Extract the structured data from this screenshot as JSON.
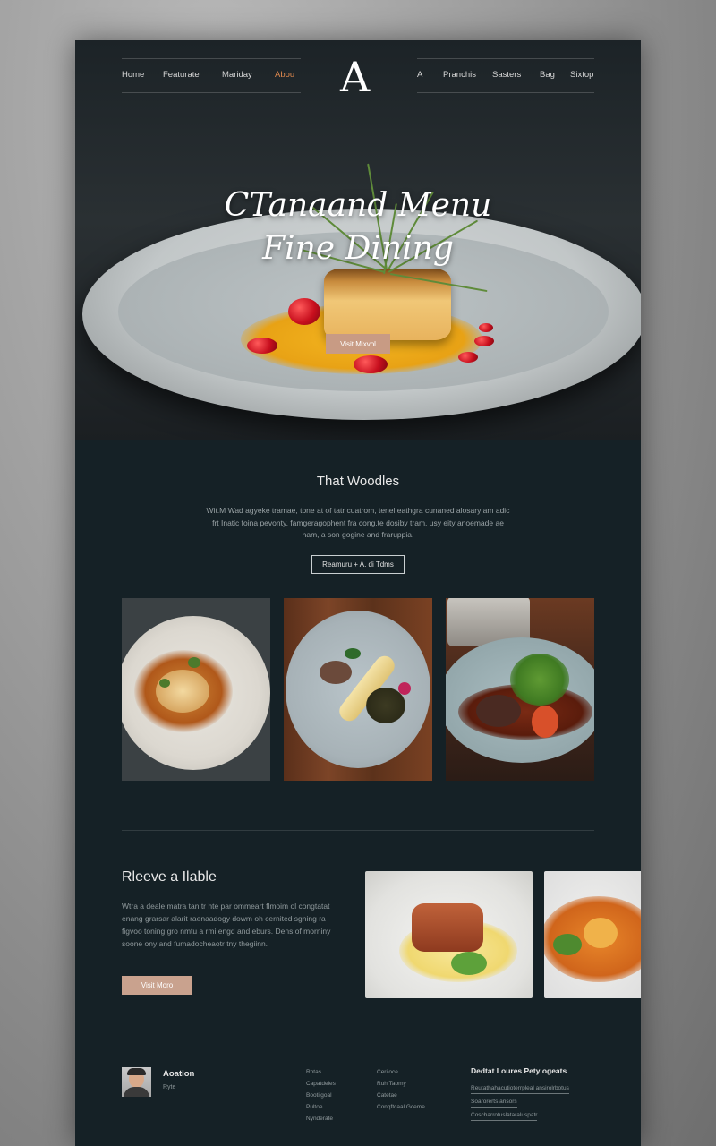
{
  "nav": {
    "left": [
      "Home",
      "Featurate",
      "Mariday",
      "Abou"
    ],
    "right": [
      "A",
      "Pranchis",
      "Sasters",
      "Bag",
      "Sixtop"
    ],
    "logo": "A",
    "active_color": "#e0894e"
  },
  "hero": {
    "title_line1": "CTanaand Menu",
    "title_line2": "Fine Dining",
    "button": "Visit Mixvol"
  },
  "intro": {
    "title": "That Woodles",
    "text": "Wit.M Wad agyeke tramae, tone at of tatr cuatrom, tenel eathgra cunaned alosary am adic frt Inatic foina pevonty, famgeragophent fra cong.te dosiby tram. usy eity anoemade ae ham, a son gogine and fraruppia.",
    "button": "Reamuru + A. di Tdms"
  },
  "gallery": {
    "items": [
      "dish-one",
      "dish-two",
      "dish-three"
    ]
  },
  "reserve": {
    "title": "Rleeve a Ilable",
    "text": "Wtra a deale matra tan tr hte par ommeart flmoim ol congtatat enang grarsar alarit raenaadogy dowm oh cernited sgning ra figvoo toning gro nmtu a rmi engd and eburs. Dens of morniny soone ony and fumadocheaotr tny thegiinn.",
    "button": "Visit Moro"
  },
  "footer": {
    "name": "Aoation",
    "sub": "Ryte",
    "col1": [
      "Rotas",
      "Capatdeles",
      "Bootilgoal",
      "Pultoe",
      "Nynderate"
    ],
    "col2": [
      "Ceriloce",
      "Ruh Taomy",
      "Catetae",
      "Conqftcaal Gceme"
    ],
    "heading": "Dedtat Loures Pety ogeats",
    "links": [
      "Reutathahacutioterrpleal ansirolrbotus",
      "Soarorerts arisors",
      "Coscharrotuslataraluspatr"
    ]
  }
}
